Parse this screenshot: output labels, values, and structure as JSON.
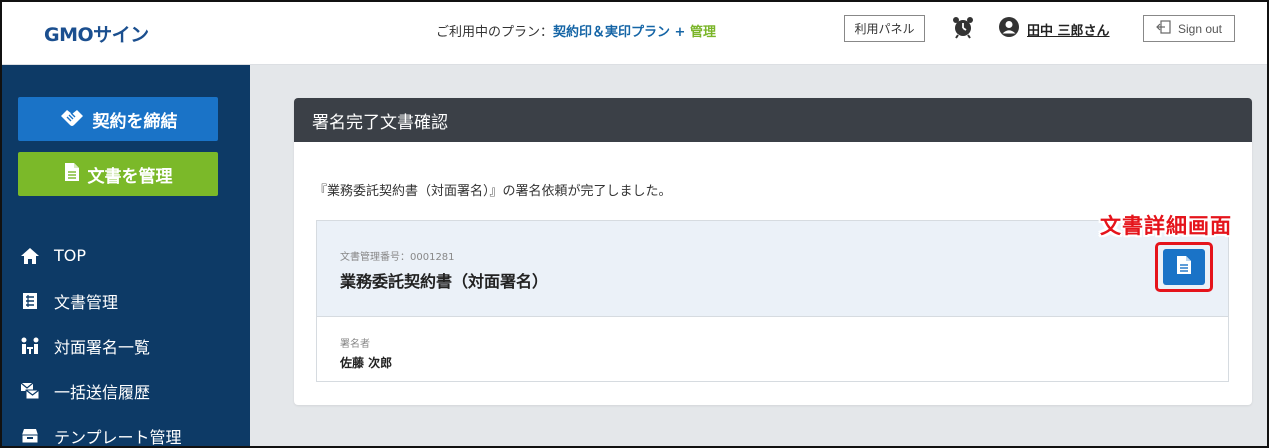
{
  "header": {
    "logo": "GMOサイン",
    "plan_prefix": "ご利用中のプラン：",
    "plan_name": "契約印＆実印プラン",
    "plan_plus": " + ",
    "plan_role": "管理",
    "panel_button": "利用パネル",
    "alarm_icon": "alarm-clock-icon",
    "user_name": "田中 三郎さん",
    "sign_out": "Sign out"
  },
  "sidebar": {
    "sign_button": "契約を締結",
    "manage_button": "文書を管理",
    "items": [
      {
        "label": "TOP",
        "icon": "home-icon"
      },
      {
        "label": "文書管理",
        "icon": "document-list-icon"
      },
      {
        "label": "対面署名一覧",
        "icon": "face-to-face-icon"
      },
      {
        "label": "一括送信履歴",
        "icon": "batch-send-icon"
      },
      {
        "label": "テンプレート管理",
        "icon": "template-icon"
      }
    ]
  },
  "main": {
    "title": "署名完了文書確認",
    "message": "『業務委託契約書（対面署名）』の署名依頼が完了しました。",
    "doc_number": "文書管理番号：0001281",
    "doc_title": "業務委託契約書（対面署名）",
    "signer_label": "署名者",
    "signer_name": "佐藤 次郎",
    "annotation": "文書詳細画面"
  },
  "colors": {
    "sidebar_bg": "#0d3a66",
    "primary_blue": "#1a73c7",
    "manage_green": "#7bb929",
    "card_header": "#3b4047",
    "highlight_red": "#e5141b"
  }
}
